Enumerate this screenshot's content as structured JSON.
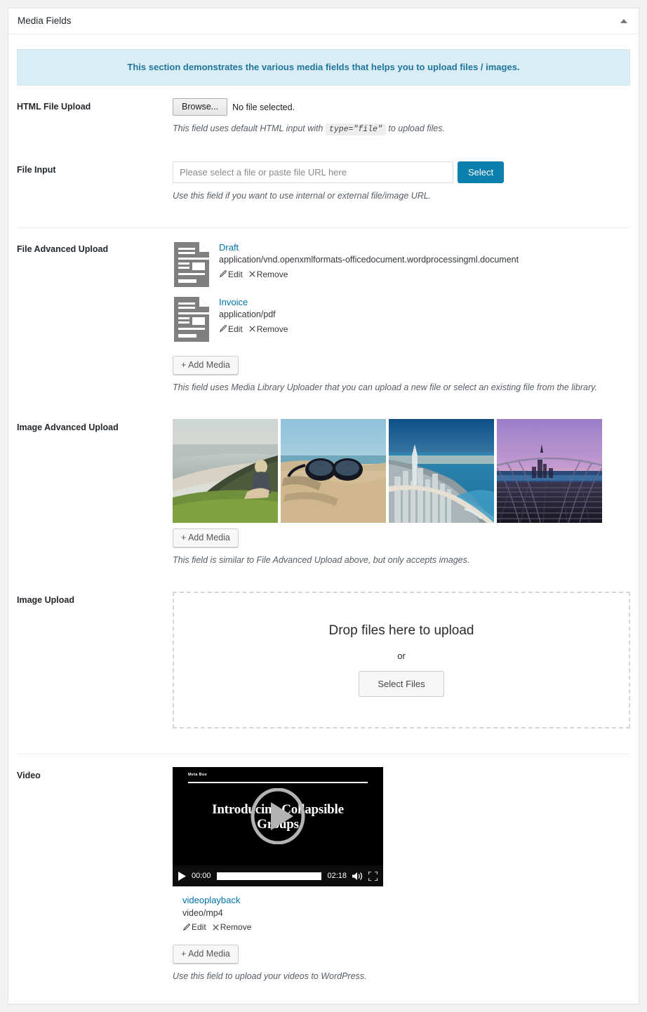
{
  "panel": {
    "title": "Media Fields",
    "toggle_icon": "caret-up-icon",
    "notice": "This section demonstrates the various media fields that helps you to upload files / images."
  },
  "fields": {
    "html_file_upload": {
      "label": "HTML File Upload",
      "browse_label": "Browse...",
      "no_file_text": "No file selected.",
      "desc_before": "This field uses default HTML input with",
      "desc_code": "type=\"file\"",
      "desc_after": "to upload files."
    },
    "file_input": {
      "label": "File Input",
      "placeholder": "Please select a file or paste file URL here",
      "value": "",
      "select_label": "Select",
      "desc": "Use this field if you want to use internal or external file/image URL."
    },
    "file_advanced_upload": {
      "label": "File Advanced Upload",
      "items": [
        {
          "name": "Draft",
          "mime": "application/vnd.openxmlformats-officedocument.wordprocessingml.document",
          "edit_label": "Edit",
          "remove_label": "Remove",
          "icon": "document-file-icon"
        },
        {
          "name": "Invoice",
          "mime": "application/pdf",
          "edit_label": "Edit",
          "remove_label": "Remove",
          "icon": "document-file-icon"
        }
      ],
      "add_media_label": "+ Add Media",
      "desc": "This field uses Media Library Uploader that you can upload a new file or select an existing file from the library."
    },
    "image_advanced_upload": {
      "label": "Image Advanced Upload",
      "images": [
        {
          "alt": "woman sitting on grassy coastal cliff overlooking beach"
        },
        {
          "alt": "black sunglasses resting on sand at the beach"
        },
        {
          "alt": "aerial view of Gold Coast skyscrapers along the shoreline"
        },
        {
          "alt": "purple sunset over bridge with city skyline reflection"
        }
      ],
      "add_media_label": "+ Add Media",
      "desc": "This field is similar to File Advanced Upload above, but only accepts images."
    },
    "image_upload": {
      "label": "Image Upload",
      "drop_title": "Drop files here to upload",
      "or_text": "or",
      "select_files_label": "Select Files"
    },
    "video": {
      "label": "Video",
      "player": {
        "brand": "Meta Box",
        "title_line_1": "Introducing Collapsible",
        "title_line_2": "Groups",
        "current_time": "00:00",
        "duration": "02:18",
        "play_icon": "play-icon",
        "mute_icon": "volume-icon",
        "fullscreen_icon": "fullscreen-icon"
      },
      "item": {
        "name": "videoplayback",
        "mime": "video/mp4",
        "edit_label": "Edit",
        "remove_label": "Remove"
      },
      "add_media_label": "+ Add Media",
      "desc": "Use this field to upload your videos to WordPress."
    }
  },
  "colors": {
    "link": "#0073aa",
    "notice_bg": "#d9edf7",
    "notice_text": "#21759b",
    "select_button": "#0b7fad"
  }
}
